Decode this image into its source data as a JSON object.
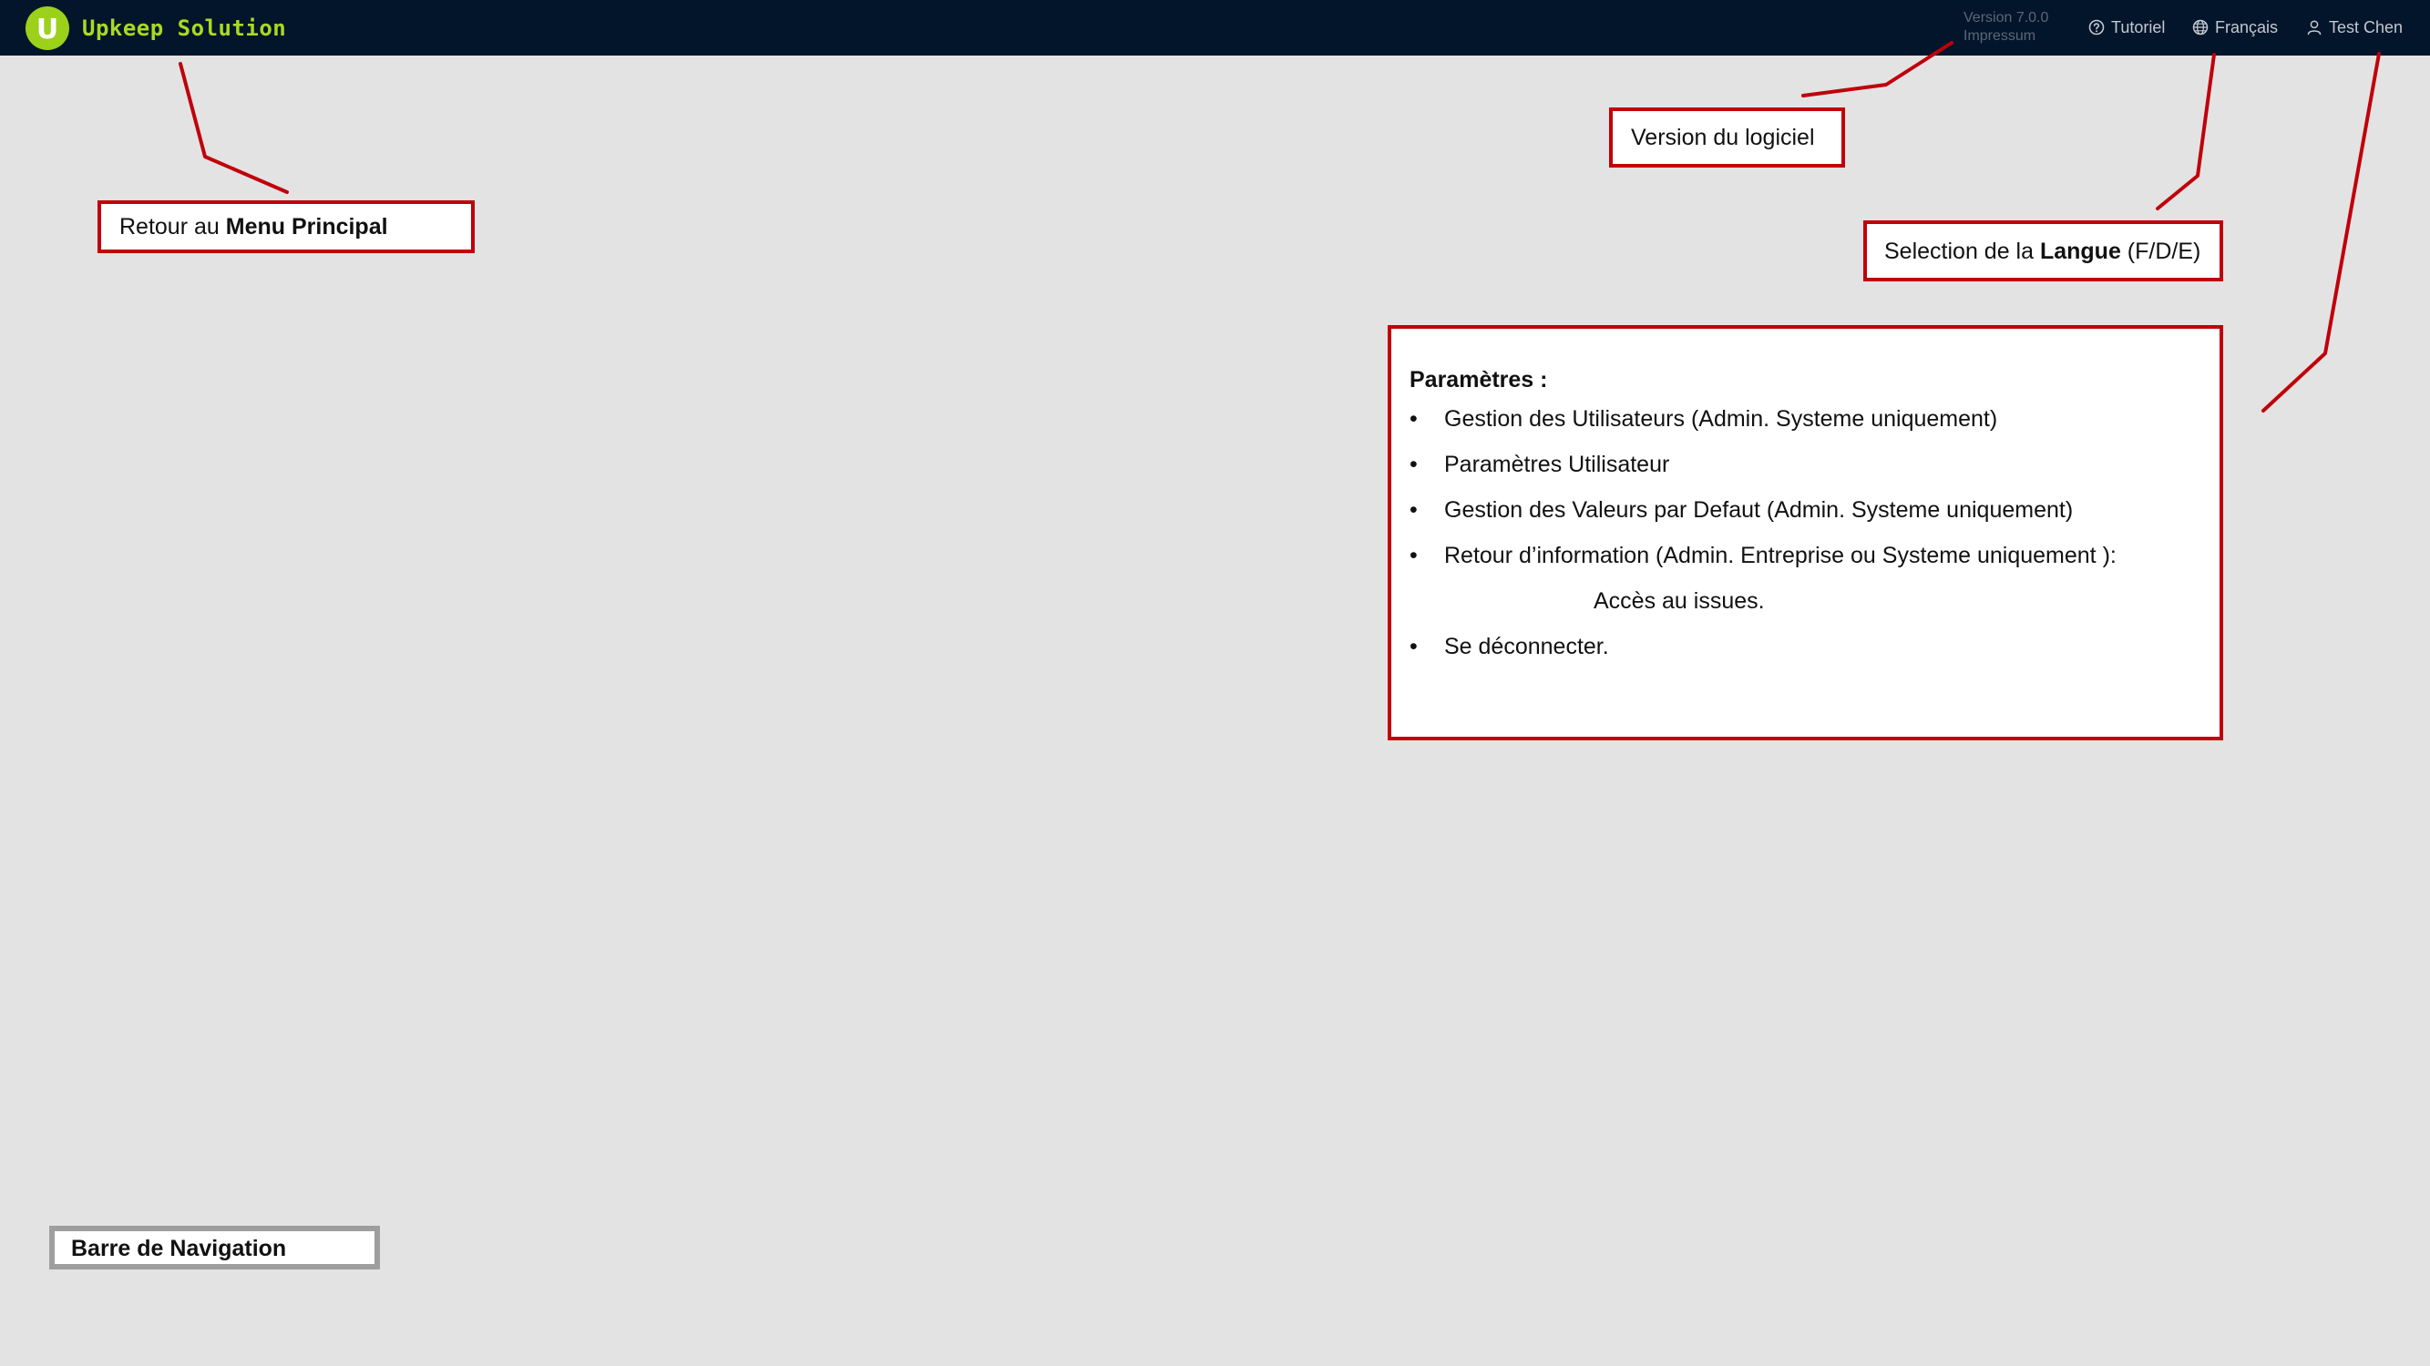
{
  "app": {
    "logo_letter": "U",
    "title": "Upkeep Solution"
  },
  "header": {
    "version": "Version 7.0.0",
    "impressum": "Impressum",
    "tutorial": "Tutoriel",
    "language": "Français",
    "user": "Test Chen"
  },
  "icons": {
    "tutorial": "question-circle-icon",
    "language": "globe-icon",
    "user": "user-icon"
  },
  "colors": {
    "navbar": "#03152b",
    "brand": "#a8da22",
    "annotation": "#c0000a"
  },
  "annotations": {
    "main_menu": {
      "prefix": "Retour au ",
      "bold": "Menu Principal"
    },
    "version": "Version du logiciel",
    "language": {
      "prefix": "Selection de la ",
      "bold": "Langue",
      "suffix": " (F/D/E)"
    },
    "parameters": {
      "title": "Paramètres :",
      "items": [
        "Gestion des Utilisateurs (Admin. Systeme uniquement)",
        "Paramètres Utilisateur",
        "Gestion des Valeurs par Defaut (Admin. Systeme uniquement)",
        "Retour d’information (Admin. Entreprise ou Systeme uniquement ):",
        "Accès au issues.",
        "Se déconnecter."
      ]
    },
    "navigation_bar": "Barre de Navigation"
  }
}
